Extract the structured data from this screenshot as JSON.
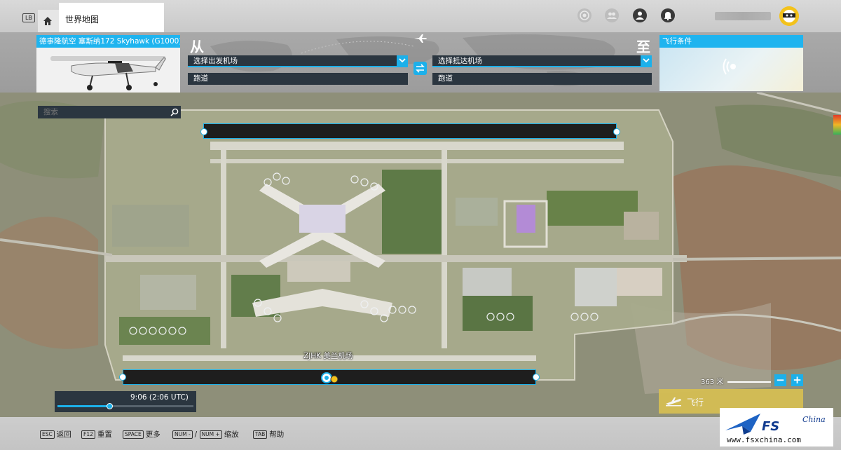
{
  "topbar": {
    "lb_key": "LB",
    "page_title": "世界地图"
  },
  "flight_panel": {
    "aircraft": "德事隆航空 塞斯纳172 Skyhawk (G1000)",
    "from_label": "从",
    "to_label": "至",
    "departure": {
      "placeholder": "选择出发机场",
      "runway": "跑道"
    },
    "arrival": {
      "placeholder": "选择抵达机场",
      "runway": "跑道"
    },
    "conditions_label": "飞行条件"
  },
  "map": {
    "search_placeholder": "搜索",
    "airport_label": "ZJHK 美兰机场",
    "scale_text": "363 米",
    "zoom_out": "−",
    "zoom_in": "+",
    "time_text": "9:06 (2:06 UTC)",
    "time_progress": 0.38,
    "fly_label": "飞行"
  },
  "shortcuts": [
    {
      "key": "ESC",
      "label": "返回"
    },
    {
      "key": "F12",
      "label": "重置"
    },
    {
      "key": "SPACE",
      "label": "更多"
    },
    {
      "key": "NUM -",
      "sep": "/",
      "key2": "NUM +",
      "label": "缩放"
    },
    {
      "key": "TAB",
      "label": "帮助"
    }
  ],
  "watermark": {
    "brand": "FS",
    "brand_suffix": "China",
    "url": "www.fsxchina.com"
  },
  "colors": {
    "accent": "#1cb0ea",
    "panel_dark": "#2b3640",
    "fly_button": "#d7bf52"
  }
}
